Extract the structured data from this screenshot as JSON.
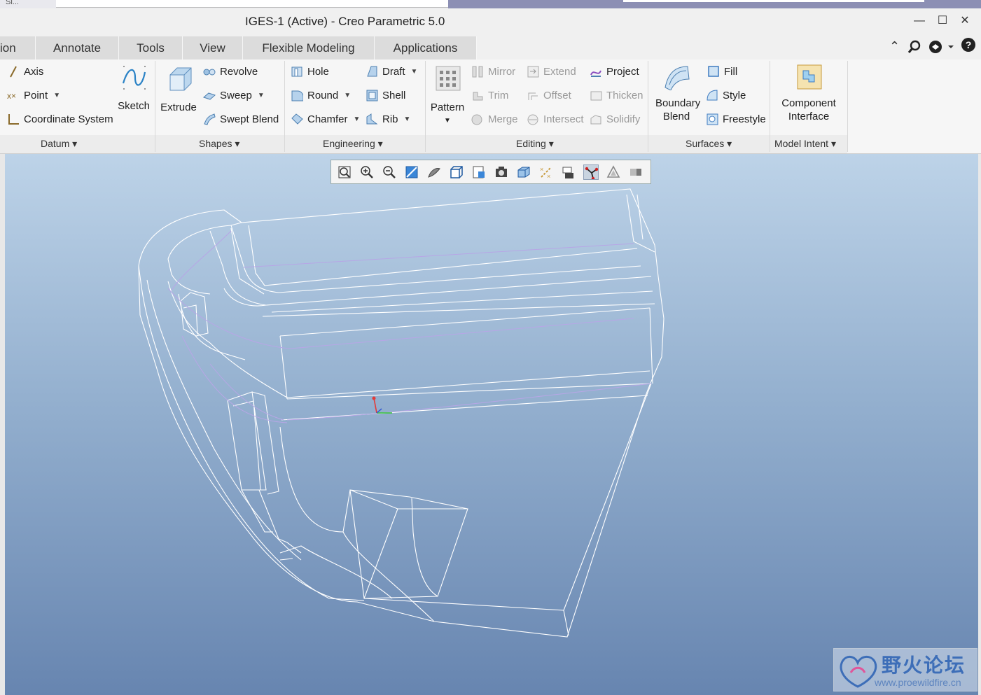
{
  "top_strip": {
    "text": "Sl..."
  },
  "window": {
    "title": "IGES-1 (Active) - Creo Parametric 5.0",
    "minimize": "—",
    "maximize": "☐",
    "close": "✕"
  },
  "tabs": [
    "ion",
    "Annotate",
    "Tools",
    "View",
    "Flexible Modeling",
    "Applications"
  ],
  "right_controls": {
    "collapse": "⌃",
    "search": "⚲",
    "help": "?"
  },
  "ribbon": {
    "datum": {
      "label": "Datum",
      "axis": "Axis",
      "point": "Point",
      "csys": "Coordinate System",
      "sketch": "Sketch"
    },
    "shapes": {
      "label": "Shapes",
      "extrude": "Extrude",
      "revolve": "Revolve",
      "sweep": "Sweep",
      "swept_blend": "Swept Blend"
    },
    "engineering": {
      "label": "Engineering",
      "hole": "Hole",
      "round": "Round",
      "chamfer": "Chamfer",
      "draft": "Draft",
      "shell": "Shell",
      "rib": "Rib"
    },
    "editing": {
      "label": "Editing",
      "pattern": "Pattern",
      "mirror": "Mirror",
      "trim": "Trim",
      "merge": "Merge",
      "extend": "Extend",
      "offset": "Offset",
      "intersect": "Intersect",
      "project": "Project",
      "thicken": "Thicken",
      "solidify": "Solidify"
    },
    "surfaces": {
      "label": "Surfaces",
      "boundary_blend": "Boundary Blend",
      "fill": "Fill",
      "style": "Style",
      "freestyle": "Freestyle"
    },
    "model_intent": {
      "label": "Model Intent",
      "component_interface": "Component Interface"
    }
  },
  "graphics_toolbar": [
    "refit-icon",
    "zoom-in-icon",
    "zoom-out-icon",
    "repaint-icon",
    "display-style-icon",
    "saved-views-icon",
    "view-manager-icon",
    "perspective-icon",
    "display-type-icon",
    "datum-display-icon",
    "spin-center-icon",
    "annotation-display-icon",
    "appearance-icon",
    "shading-icon"
  ],
  "watermark": {
    "brand": "野火论坛",
    "url": "www.proewildfire.cn"
  },
  "colors": {
    "accent_blue": "#3d6eb8",
    "viewport_top": "#bdd3e8",
    "viewport_bottom": "#6785b0"
  }
}
